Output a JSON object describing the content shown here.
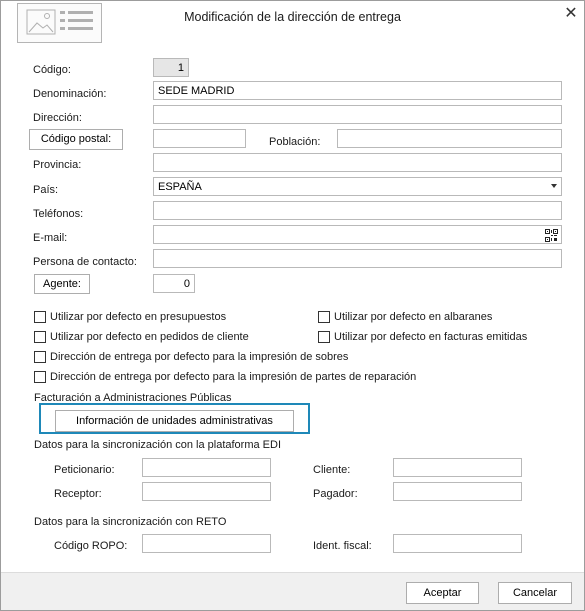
{
  "window": {
    "title": "Modificación de la dirección de entrega",
    "close_glyph": "✕"
  },
  "form": {
    "codigo_label": "Código:",
    "codigo_value": "1",
    "denominacion_label": "Denominación:",
    "denominacion_value": "SEDE MADRID",
    "direccion_label": "Dirección:",
    "direccion_value": "",
    "codigo_postal_button": "Código postal:",
    "codigo_postal_value": "",
    "poblacion_label": "Población:",
    "poblacion_value": "",
    "provincia_label": "Provincia:",
    "provincia_value": "",
    "pais_label": "País:",
    "pais_value": "ESPAÑA",
    "telefonos_label": "Teléfonos:",
    "telefonos_value": "",
    "email_label": "E-mail:",
    "email_value": "",
    "contacto_label": "Persona de contacto:",
    "contacto_value": "",
    "agente_button": "Agente:",
    "agente_value": "0"
  },
  "checkboxes": {
    "presupuestos": "Utilizar por defecto en presupuestos",
    "albaranes": "Utilizar por defecto en albaranes",
    "pedidos": "Utilizar por defecto en pedidos de cliente",
    "facturas": "Utilizar por defecto en facturas emitidas",
    "sobres": "Dirección de entrega por defecto para la impresión de sobres",
    "partes": "Dirección de entrega por defecto para la impresión de partes de reparación"
  },
  "admin": {
    "section_label": "Facturación a Administraciones Públicas",
    "button_label": "Información de unidades administrativas"
  },
  "edi": {
    "section_label": "Datos para la sincronización con la plataforma EDI",
    "peticionario_label": "Peticionario:",
    "cliente_label": "Cliente:",
    "receptor_label": "Receptor:",
    "pagador_label": "Pagador:"
  },
  "reto": {
    "section_label": "Datos para la sincronización con RETO",
    "ropo_label": "Código ROPO:",
    "ident_label": "Ident. fiscal:"
  },
  "footer": {
    "accept_label": "Aceptar",
    "cancel_label": "Cancelar"
  },
  "colors": {
    "focus_border": "#1e88b8",
    "readonly_field": "#e6e6e6"
  },
  "icons": {
    "logo": "address-card-icon",
    "close": "close-icon",
    "dropdown": "chevron-down-icon",
    "email": "qr-code-icon"
  }
}
